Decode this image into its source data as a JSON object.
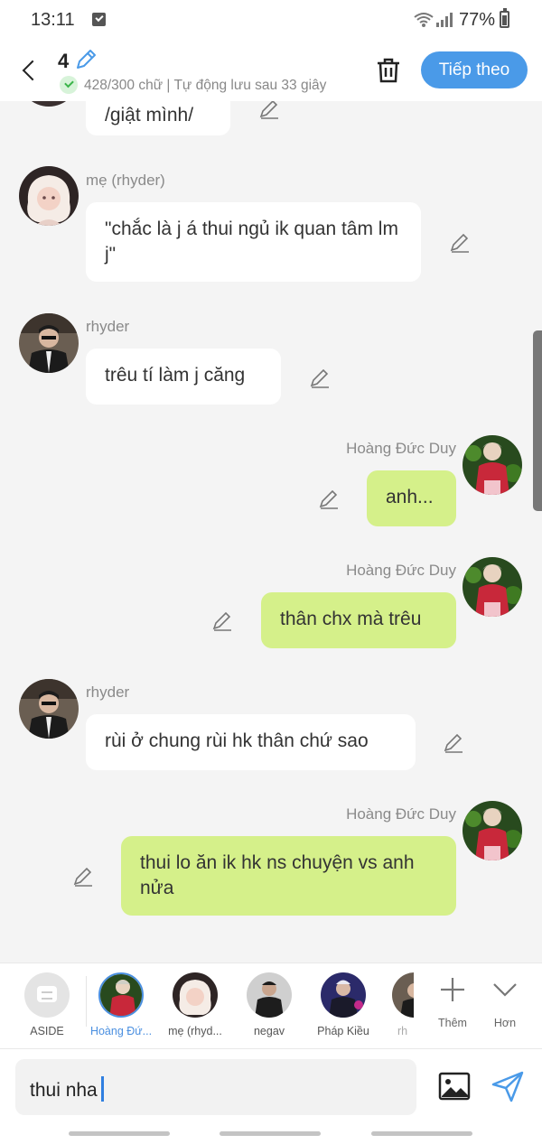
{
  "status_bar": {
    "time": "13:11",
    "battery": "77%"
  },
  "header": {
    "chapter_number": "4",
    "save_status": "428/300 chữ | Tự động lưu sau 33 giây",
    "next_label": "Tiếp theo"
  },
  "messages": [
    {
      "side": "left",
      "sender": "",
      "text": "/giật mình/"
    },
    {
      "side": "left",
      "sender": "mẹ (rhyder)",
      "text": "\"chắc là j á thui ngủ ik quan tâm lm j\""
    },
    {
      "side": "left",
      "sender": "rhyder",
      "text": "trêu tí làm j căng"
    },
    {
      "side": "right",
      "sender": "Hoàng Đức Duy",
      "text": "anh..."
    },
    {
      "side": "right",
      "sender": "Hoàng Đức Duy",
      "text": "thân chx mà trêu"
    },
    {
      "side": "left",
      "sender": "rhyder",
      "text": "rùi ở chung rùi hk thân chứ sao"
    },
    {
      "side": "right",
      "sender": "Hoàng Đức Duy",
      "text": "thui lo ăn ik hk ns chuyện vs anh nửa"
    }
  ],
  "characters": [
    {
      "label": "ASIDE",
      "selected": false
    },
    {
      "label": "Hoàng Đứ...",
      "selected": true
    },
    {
      "label": "mẹ (rhyd...",
      "selected": false
    },
    {
      "label": "negav",
      "selected": false
    },
    {
      "label": "Pháp Kiều",
      "selected": false
    },
    {
      "label": "rh",
      "selected": false
    }
  ],
  "bar_actions": {
    "add_label": "Thêm",
    "more_label": "Hơn"
  },
  "input": {
    "value": "thui nha"
  },
  "colors": {
    "accent": "#4a9ae8",
    "right_bubble": "#d5f08a",
    "left_bubble": "#ffffff"
  }
}
